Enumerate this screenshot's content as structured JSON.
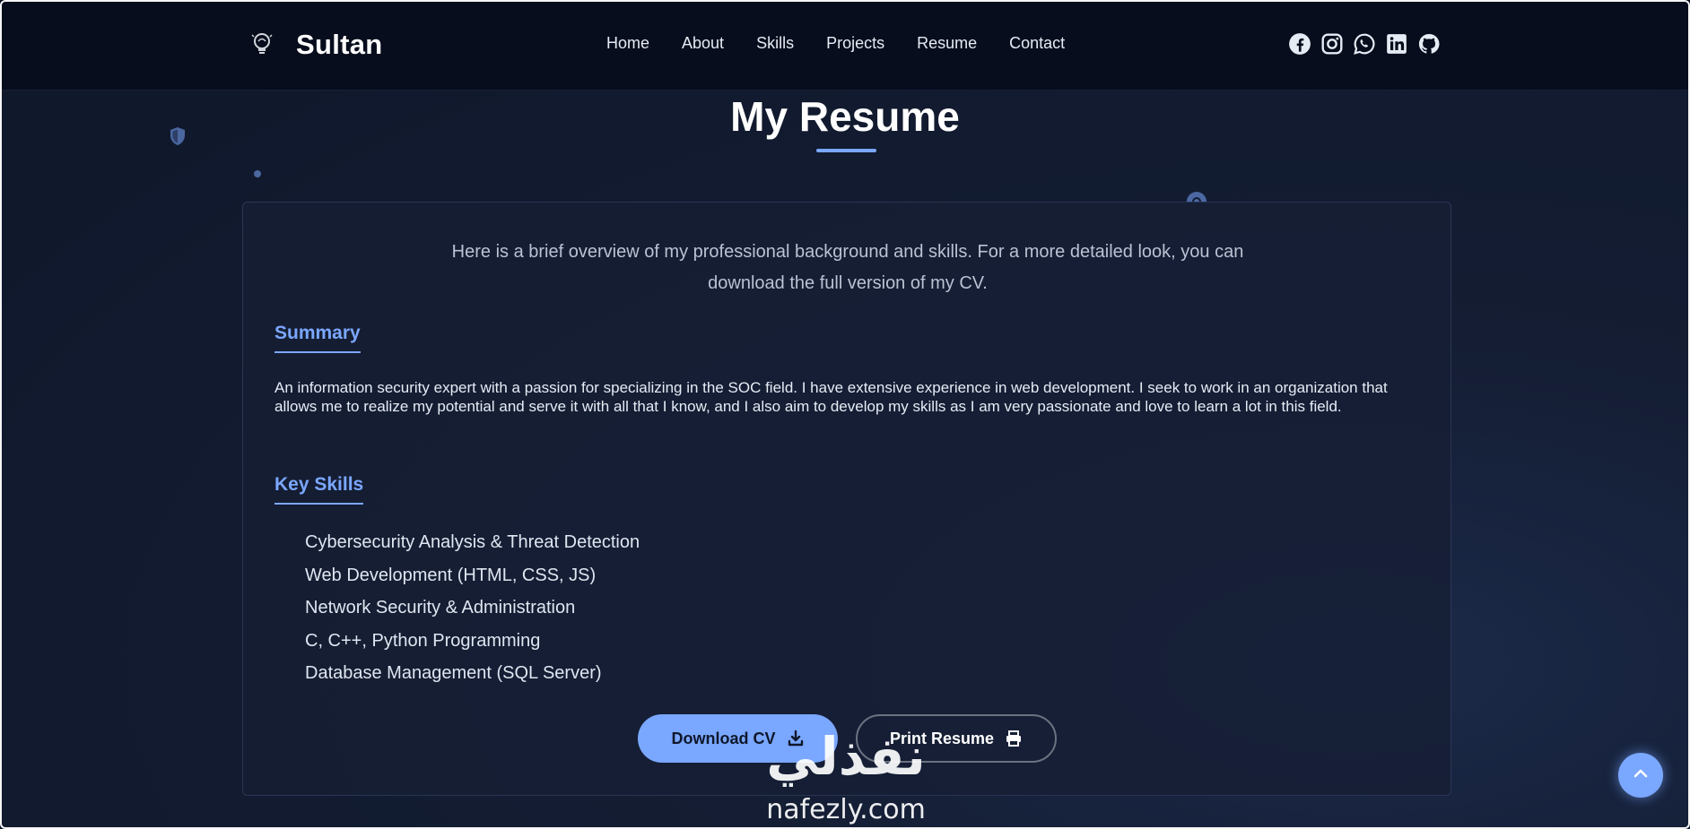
{
  "navbar": {
    "brand_name": "Sultan",
    "brand_icon": "lightbulb-icon",
    "links": [
      "Home",
      "About",
      "Skills",
      "Projects",
      "Resume",
      "Contact"
    ],
    "social_icons": [
      "facebook-icon",
      "instagram-icon",
      "whatsapp-icon",
      "linkedin-icon",
      "github-icon"
    ]
  },
  "page": {
    "title": "My Resume",
    "intro_line1": "Here is a brief overview of my professional background and skills. For a more detailed look, you can",
    "intro_line2": "download the full version of my CV."
  },
  "summary": {
    "heading": "Summary",
    "text": "An information security expert with a passion for specializing in the SOC field. I have extensive experience in web development. I seek to work in an organization that allows me to realize my potential and serve it with all that I know, and I also aim to develop my skills as I am very passionate and love to learn a lot in this field."
  },
  "skills": {
    "heading": "Key Skills",
    "items": [
      "Cybersecurity Analysis & Threat Detection",
      "Web Development (HTML, CSS, JS)",
      "Network Security & Administration",
      "C, C++, Python Programming",
      "Database Management (SQL Server)"
    ]
  },
  "buttons": {
    "download_label": "Download CV",
    "download_icon": "download-icon",
    "print_label": "Print Resume",
    "print_icon": "printer-icon"
  },
  "watermark": {
    "arabic": "نفذلي",
    "latin": "nafezly.com"
  },
  "scroll_top_icon": "chevron-up-icon",
  "colors": {
    "accent": "#7aa7ff",
    "navbar_bg": "#070d1c",
    "page_bg": "#111a2e",
    "card_bg": "#161e34"
  }
}
